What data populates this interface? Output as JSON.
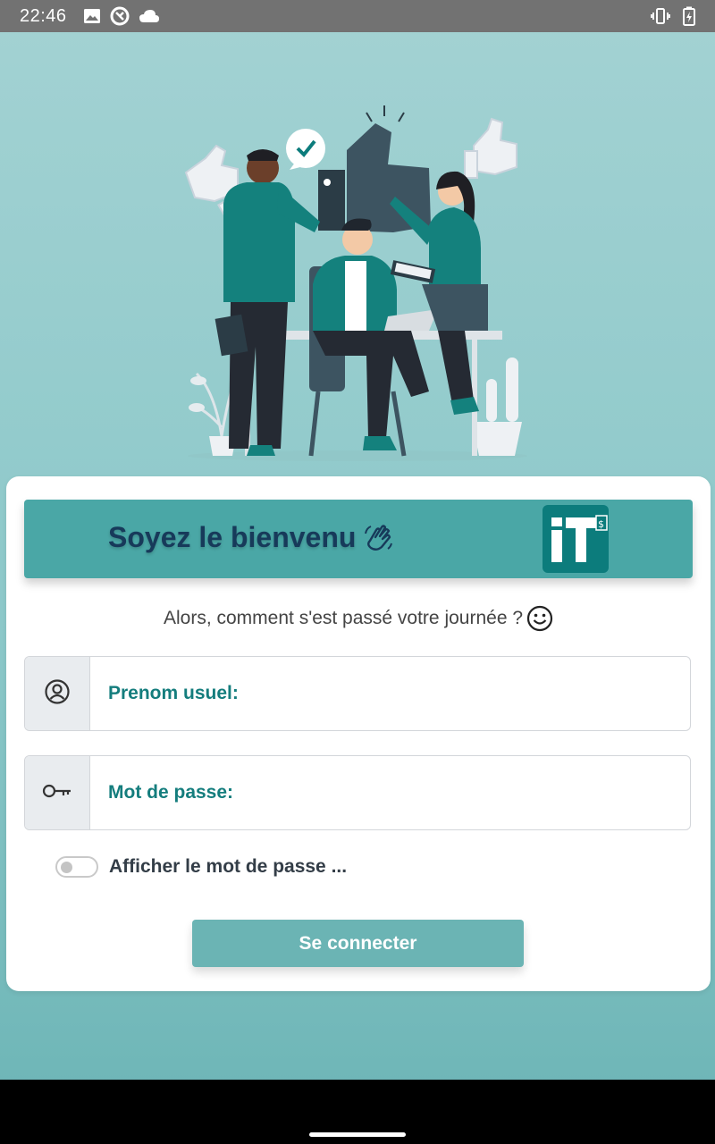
{
  "status_bar": {
    "time": "22:46",
    "left_icons": [
      "image-icon",
      "data-saver-icon",
      "cloud-icon"
    ],
    "right_icons": [
      "vibrate-icon",
      "battery-charging-icon"
    ]
  },
  "card": {
    "welcome_title": "Soyez le bienvenu",
    "subtitle": "Alors, comment s'est passé votre journée ?",
    "username_placeholder": "Prenom usuel:",
    "password_placeholder": "Mot de passe:",
    "show_password_label": "Afficher le mot de passe ...",
    "show_password_checked": false,
    "login_button": "Se connecter"
  },
  "colors": {
    "primary": "#4aa7a6",
    "logo": "#0c7c7c",
    "title": "#173a5a",
    "button": "#6bb4b4"
  }
}
